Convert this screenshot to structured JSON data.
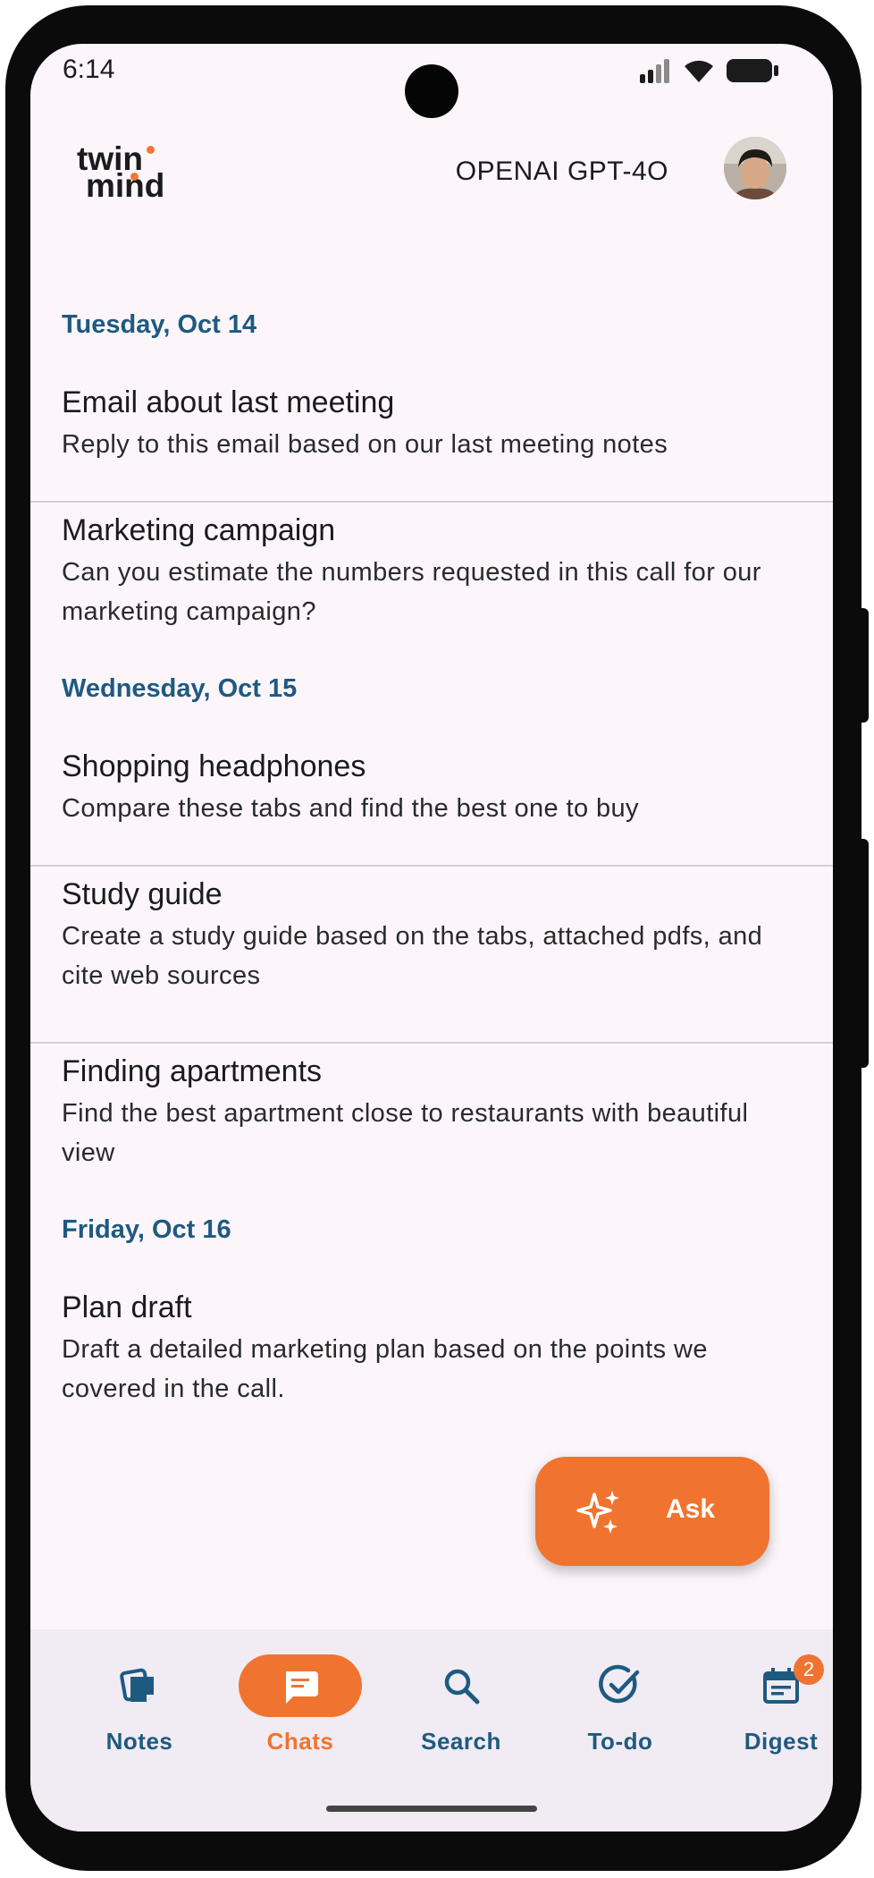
{
  "status_bar": {
    "time": "6:14"
  },
  "header": {
    "logo_line1": "twin",
    "logo_line2": "mind",
    "model_label": "OPENAI GPT-4O"
  },
  "chat_groups": [
    {
      "date": "Tuesday, Oct 14",
      "chats": [
        {
          "title": "Email about last meeting",
          "subtitle": "Reply to this email based on our last meeting notes"
        },
        {
          "title": "Marketing campaign",
          "subtitle": "Can you estimate the numbers requested in this call for our marketing campaign?"
        }
      ]
    },
    {
      "date": "Wednesday, Oct 15",
      "chats": [
        {
          "title": "Shopping headphones",
          "subtitle": "Compare these tabs and find the best one to buy"
        },
        {
          "title": "Study guide",
          "subtitle": "Create a study guide based on the tabs, attached pdfs, and cite web sources"
        },
        {
          "title": "Finding apartments",
          "subtitle": "Find the best apartment close to restaurants with beautiful view"
        }
      ]
    },
    {
      "date": "Friday, Oct 16",
      "chats": [
        {
          "title": "Plan draft",
          "subtitle": "Draft a detailed marketing plan based on the points we covered in the call."
        }
      ]
    }
  ],
  "ask_button": {
    "label": "Ask"
  },
  "nav": {
    "items": [
      {
        "label": "Notes",
        "icon": "notes-icon"
      },
      {
        "label": "Chats",
        "icon": "chat-bubble-icon",
        "active": true
      },
      {
        "label": "Search",
        "icon": "search-icon"
      },
      {
        "label": "To-do",
        "icon": "check-circle-icon"
      },
      {
        "label": "Digest",
        "icon": "calendar-digest-icon",
        "badge": "2"
      }
    ]
  },
  "colors": {
    "accent": "#f07430",
    "date_header": "#1e5a80",
    "background": "#fcf6fb",
    "navbar": "#f1ebf4"
  }
}
